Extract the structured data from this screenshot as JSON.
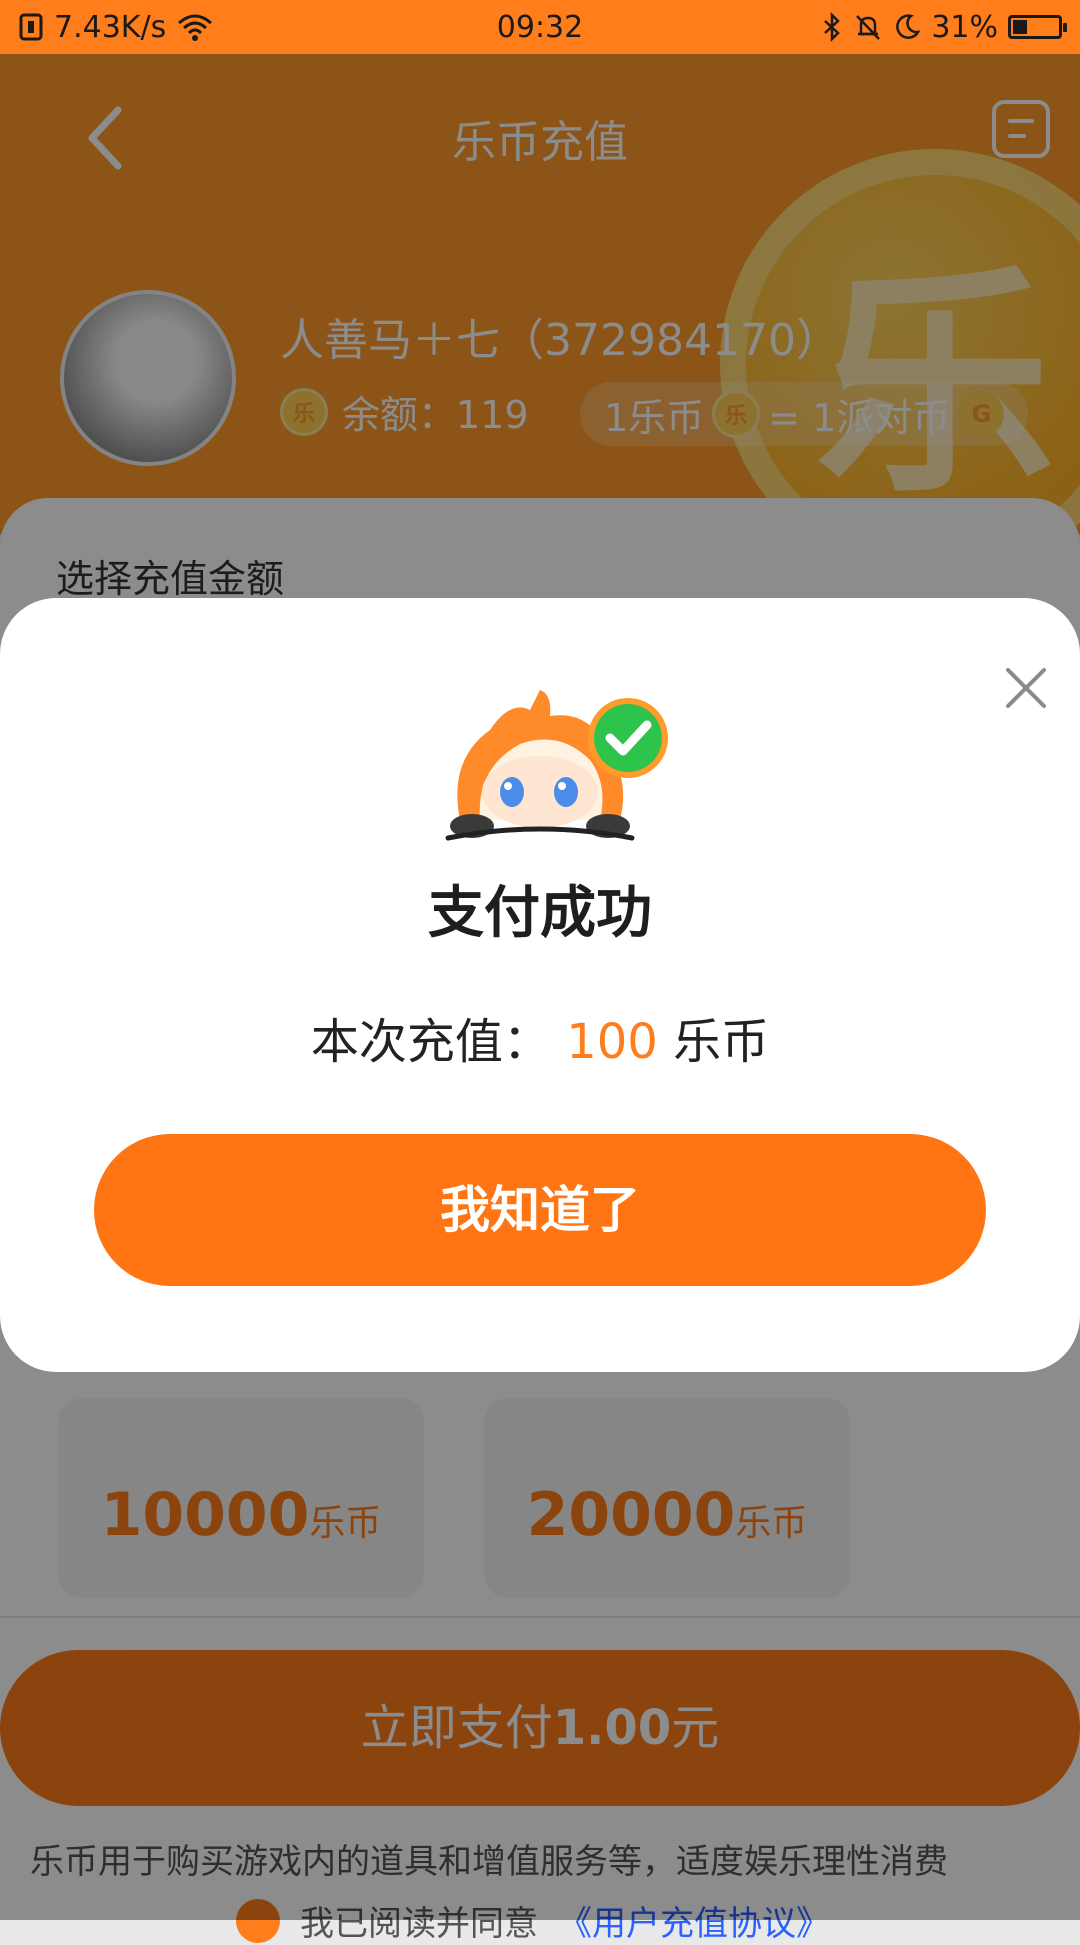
{
  "status_bar": {
    "speed": "7.43K/s",
    "time": "09:32",
    "battery": "31%",
    "battery_level": 0.31
  },
  "header": {
    "title": "乐币充值",
    "username": "人善马＋七（372984170）",
    "balance_label": "余额：119",
    "rate_left": "1乐币",
    "rate_right": "= 1派对币",
    "coin_char": "乐",
    "g_char": "G"
  },
  "main": {
    "section_label": "选择充值金额",
    "options": [
      {
        "amount": "10000",
        "unit": "乐币"
      },
      {
        "amount": "20000",
        "unit": "乐币"
      }
    ],
    "pay_button_prefix": "立即支付",
    "pay_button_amount": "1.00",
    "pay_button_suffix": "元",
    "footnote": "乐币用于购买游戏内的道具和增值服务等，适度娱乐理性消费",
    "agree_text": "我已阅读并同意",
    "agreement_link": "《用户充值协议》"
  },
  "modal": {
    "title": "支付成功",
    "recharge_label": "本次充值：",
    "recharge_amount": "100",
    "recharge_unit": "乐币",
    "confirm_label": "我知道了"
  },
  "colors": {
    "accent": "#ff7d1a",
    "header_bg": "#ff9b2a",
    "link": "#2962ff",
    "success_green": "#2ec34a"
  }
}
